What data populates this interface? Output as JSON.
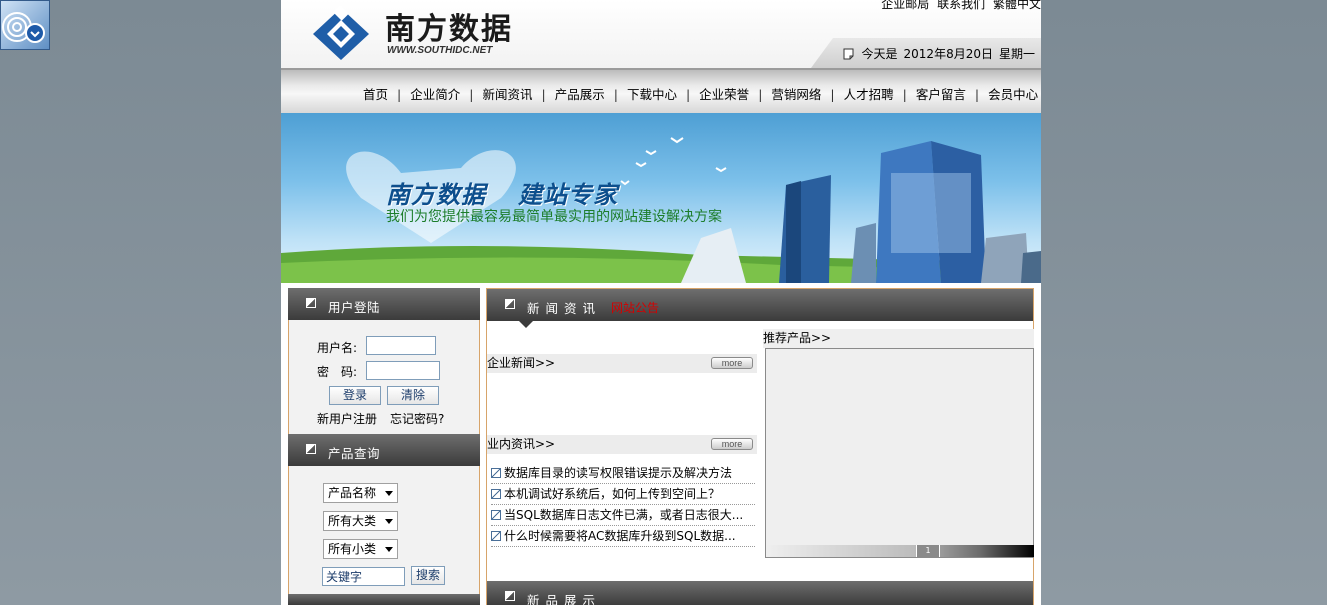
{
  "header": {
    "logo_cn": "南方数据",
    "logo_en": "WWW.SOUTHIDC.NET",
    "top_links": [
      "企业邮局",
      "联系我们",
      "繁體中文"
    ],
    "date_label": "今天是",
    "date_value": "2012年8月20日",
    "weekday": "星期一"
  },
  "nav": {
    "items": [
      "首页",
      "企业简介",
      "新闻资讯",
      "产品展示",
      "下载中心",
      "企业荣誉",
      "营销网络",
      "人才招聘",
      "客户留言",
      "会员中心"
    ]
  },
  "banner": {
    "title_1": "南方数据",
    "title_2": "建站专家",
    "subtitle": "我们为您提供最容易最简单最实用的网站建设解决方案"
  },
  "login": {
    "title": "用户登陆",
    "username_label": "用户名:",
    "password_label": "密　码:",
    "login_button": "登录",
    "clear_button": "清除",
    "register_link": "新用户注册",
    "forgot_link": "忘记密码?"
  },
  "product_search": {
    "title": "产品查询",
    "select_name": "产品名称",
    "select_big": "所有大类",
    "select_small": "所有小类",
    "keyword_value": "关键字",
    "search_button": "搜索"
  },
  "news": {
    "title": "新闻资讯",
    "scroll_text": "网站公告",
    "company_news_label": "企业新闻>>",
    "industry_news_label": "业内资讯>>",
    "more_label": "more",
    "items": [
      "数据库目录的读写权限错误提示及解决方法",
      "本机调试好系统后，如何上传到空间上？",
      "当SQL数据库日志文件已满，或者日志很大...",
      "什么时候需要将AC数据库升级到SQL数据..."
    ]
  },
  "products": {
    "recommend_label": "推荐产品>>",
    "page_number": "1",
    "new_products_title": "新品展示"
  },
  "colors": {
    "accent_border": "#d7a46a",
    "panel_dark": "#3b3b3b",
    "highlight_red": "#d40000"
  }
}
